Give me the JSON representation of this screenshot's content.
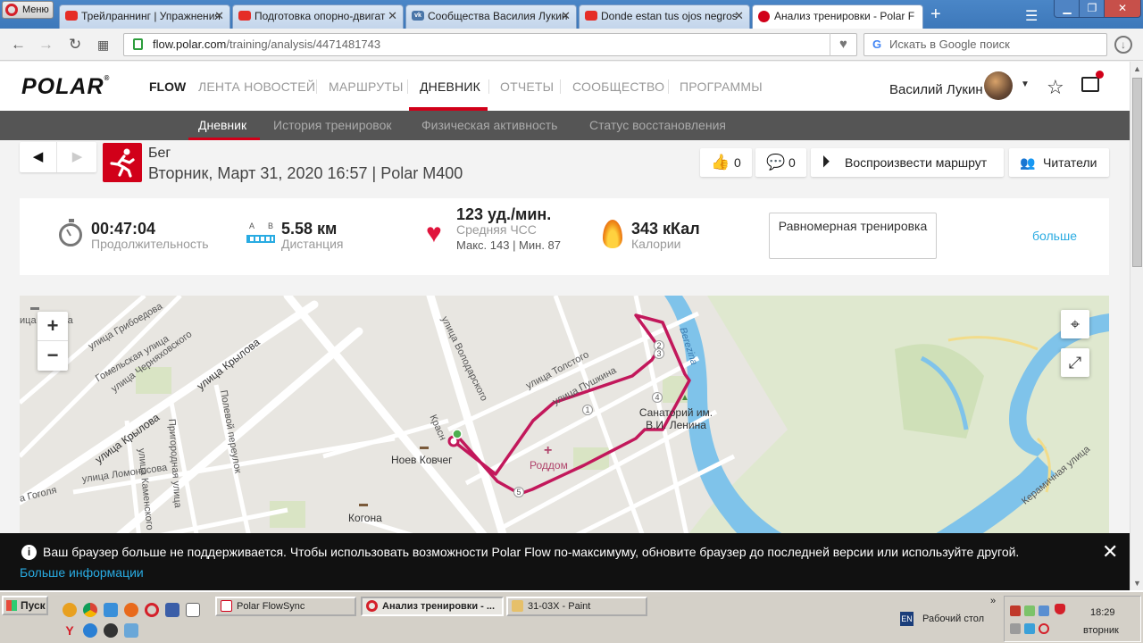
{
  "browser": {
    "menu_label": "Меню",
    "tabs": [
      {
        "title": "Трейлраннинг | Упражнения",
        "icon": "youtube-icon"
      },
      {
        "title": "Подготовка опорно-двигат",
        "icon": "youtube-icon"
      },
      {
        "title": "Сообщества Василия Лукин",
        "icon": "vk-icon"
      },
      {
        "title": "Donde estan tus ojos negros",
        "icon": "youtube-icon"
      },
      {
        "title": "Анализ тренировки - Polar F",
        "icon": "polar-icon"
      }
    ],
    "url_host": "flow.polar.com",
    "url_path": "/training/analysis/4471481743",
    "search_placeholder": "Искать в Google поиск"
  },
  "topnav": {
    "logo": "POLAR",
    "flow": "FLOW",
    "items": [
      "ЛЕНТА НОВОСТЕЙ",
      "МАРШРУТЫ",
      "ДНЕВНИК",
      "ОТЧЕТЫ",
      "СООБЩЕСТВО",
      "ПРОГРАММЫ"
    ],
    "active_item": "ДНЕВНИК",
    "username": "Василий Лукин"
  },
  "subnav": {
    "items": [
      "Дневник",
      "История тренировок",
      "Физическая активность",
      "Статус восстановления"
    ],
    "active_item": "Дневник"
  },
  "session": {
    "sport": "Бег",
    "date_device": "Вторник, Март 31, 2020 16:57 | Polar M400",
    "likes": "0",
    "comments": "0",
    "replay_label": "Воспроизвести маршрут",
    "followers_label": "Читатели"
  },
  "stats": {
    "duration": {
      "value": "00:47:04",
      "label": "Продолжительность"
    },
    "distance": {
      "value": "5.58 км",
      "label": "Дистанция",
      "icon_a": "A",
      "icon_b": "B"
    },
    "heart_rate": {
      "value": "123 уд./мин.",
      "label": "Средняя ЧСС",
      "detail": "Макс. 143 | Мин. 87"
    },
    "calories": {
      "value": "343 кКал",
      "label": "Калории"
    },
    "workout_type": "Равномерная тренировка",
    "more_label": "больше"
  },
  "map": {
    "labels": {
      "griboedova": "улица Грибоедова",
      "gomelskaya": "Гомельская улица",
      "chernyakhovskogo": "улица Черняховского",
      "krylova1": "улица Крылова",
      "krylova2": "улица Крылова",
      "prigorodnaya": "Пригородная улица",
      "kamenskogo": "улица Каменского",
      "polevoy": "Полевой переулок",
      "lomonosova": "улица Ломоносова",
      "gogolya": "а Гоголя",
      "marksa": "ица Маркса",
      "volodarskogo": "улица Володарского",
      "tolstogo": "улица Толстого",
      "pushkina": "улица Пушкина",
      "krasn": "Красн",
      "noev": "Ноев Ковчег",
      "kogona": "Когона",
      "roddom": "Роддом",
      "sanatorium": "Санаторий им. В.И. Ленина",
      "berezina": "Berezina",
      "keramicheskaya": "Керамичная улица"
    },
    "lap_markers": [
      "1",
      "2",
      "3",
      "4",
      "5"
    ]
  },
  "notice": {
    "message": "Ваш браузер больше не поддерживается. Чтобы использовать возможности Polar Flow по-максимуму, обновите браузер до последней версии или используйте другой.",
    "more_link": "Больше информации"
  },
  "taskbar": {
    "start": "Пуск",
    "tasks": [
      "Polar FlowSync",
      "Анализ тренировки - ...",
      "31-03X - Paint"
    ],
    "lang": "EN",
    "desktop": "Рабочий стол",
    "time": "18:29",
    "day": "вторник"
  },
  "colors": {
    "polar_red": "#d10019",
    "link_blue": "#29abe2",
    "route": "#c2185b",
    "river": "#2fa8e6"
  }
}
